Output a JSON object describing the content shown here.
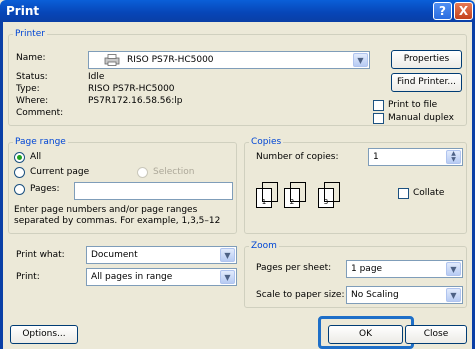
{
  "window": {
    "title": "Print",
    "help_glyph": "?",
    "close_glyph": "X"
  },
  "printer": {
    "group_label": "Printer",
    "name_label": "Name:",
    "name_value": "RISO PS7R-HC5000",
    "properties_label": "Properties",
    "find_printer_label": "Find Printer...",
    "status_label": "Status:",
    "status_value": "Idle",
    "type_label": "Type:",
    "type_value": "RISO PS7R-HC5000",
    "where_label": "Where:",
    "where_value": "PS7R172.16.58.56:lp",
    "comment_label": "Comment:",
    "comment_value": "",
    "print_to_file_label": "Print to file",
    "manual_duplex_label": "Manual duplex"
  },
  "page_range": {
    "group_label": "Page range",
    "all_label": "All",
    "current_page_label": "Current page",
    "selection_label": "Selection",
    "pages_label": "Pages:",
    "pages_value": "",
    "help_text_1": "Enter page numbers and/or page ranges",
    "help_text_2": "separated by commas.  For example, 1,3,5–12"
  },
  "copies": {
    "group_label": "Copies",
    "number_label": "Number of copies:",
    "number_value": "1",
    "collate_label": "Collate",
    "collate_pages": [
      "1",
      "2",
      "3",
      "1",
      "2",
      "3"
    ]
  },
  "print_what": {
    "label": "Print what:",
    "value": "Document"
  },
  "print": {
    "label": "Print:",
    "value": "All pages in range"
  },
  "zoom": {
    "group_label": "Zoom",
    "pages_per_sheet_label": "Pages per sheet:",
    "pages_per_sheet_value": "1 page",
    "scale_label": "Scale to paper size:",
    "scale_value": "No Scaling"
  },
  "footer": {
    "options_label": "Options...",
    "ok_label": "OK",
    "close_label": "Close"
  },
  "colors": {
    "title_bar": "#0745b6",
    "dialog_bg": "#ece9d8",
    "group_label": "#0046d5",
    "ok_highlight": "#1e6fc8"
  },
  "icons": {
    "printer": "printer-icon",
    "dropdown": "chevron-down-icon",
    "spinner": "spinner-arrows-icon"
  }
}
